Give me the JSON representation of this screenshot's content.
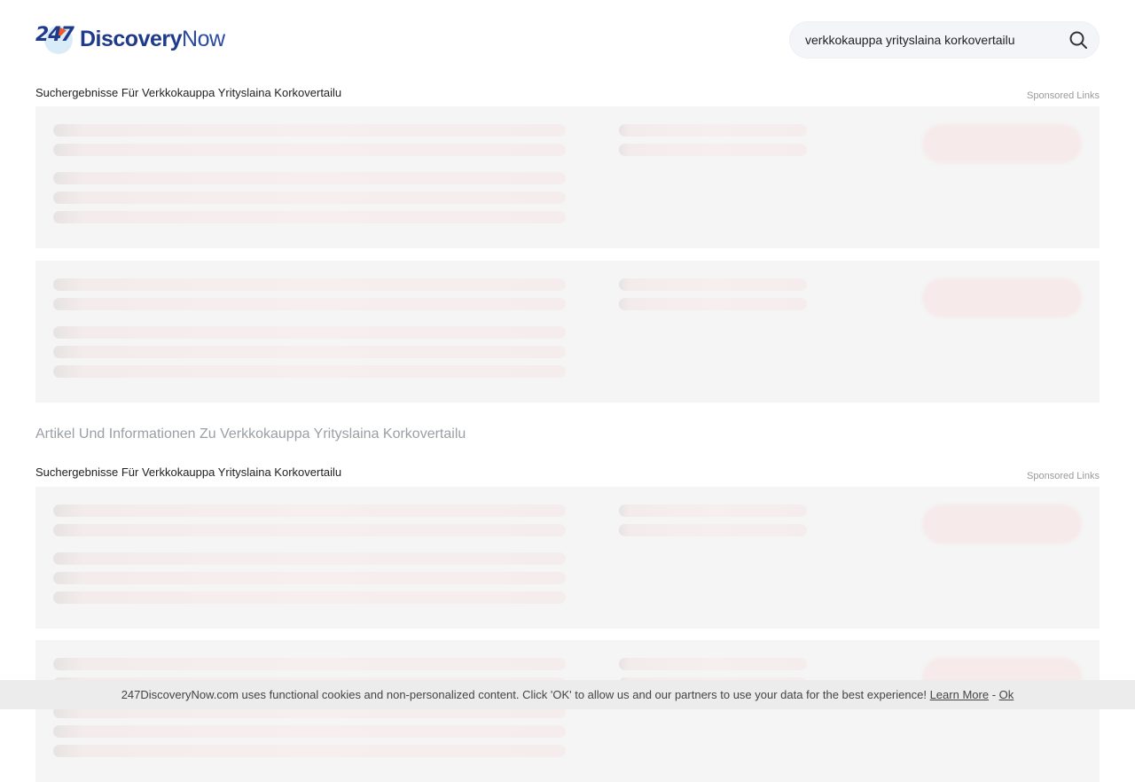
{
  "logo": {
    "digits": "247",
    "word_bold": "Discovery",
    "word_light": "Now"
  },
  "search": {
    "value": "verkkokauppa yrityslaina korkovertailu"
  },
  "sections": [
    {
      "title": "Suchergebnisse Für Verkkokauppa Yrityslaina Korkovertailu",
      "sponsored": "Sponsored Links"
    },
    {
      "title": "Suchergebnisse Für Verkkokauppa Yrityslaina Korkovertailu",
      "sponsored": "Sponsored Links"
    }
  ],
  "article_heading": "Artikel Und Informationen Zu Verkkokauppa Yrityslaina Korkovertailu",
  "cookie": {
    "text": "247DiscoveryNow.com uses functional cookies and non-personalized content. Click 'OK' to allow us and our partners to use your data for the best experience!",
    "learn_more": "Learn More",
    "separator": "-",
    "ok": "Ok"
  }
}
